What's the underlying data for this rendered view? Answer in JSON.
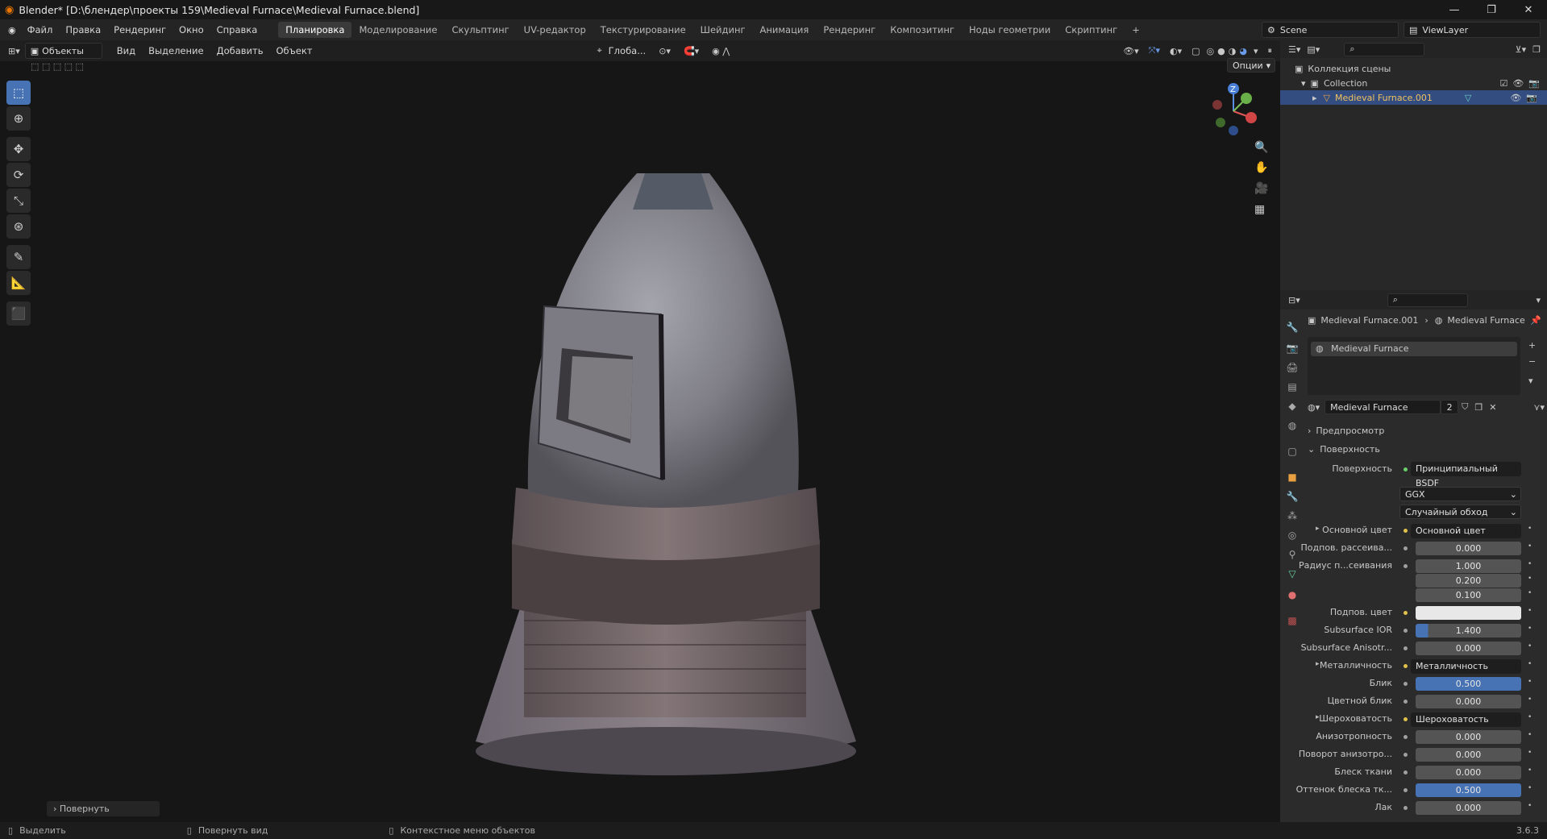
{
  "window": {
    "title": "Blender* [D:\\блендер\\проекты 159\\Medieval Furnace\\Medieval Furnace.blend]"
  },
  "menus": [
    "Файл",
    "Правка",
    "Рендеринг",
    "Окно",
    "Справка"
  ],
  "workspaces": [
    "Планировка",
    "Моделирование",
    "Скульптинг",
    "UV-редактор",
    "Текстурирование",
    "Шейдинг",
    "Анимация",
    "Рендеринг",
    "Композитинг",
    "Ноды геометрии",
    "Скриптинг"
  ],
  "active_workspace": "Планировка",
  "scene": "Scene",
  "view_layer": "ViewLayer",
  "viewport": {
    "mode": "Объекты",
    "menus": [
      "Вид",
      "Выделение",
      "Добавить",
      "Объект"
    ],
    "orientation": "Глоба...",
    "options": "Опции",
    "last_op": "Повернуть"
  },
  "outliner": {
    "root": "Коллекция сцены",
    "collection": "Collection",
    "object": "Medieval Furnace.001"
  },
  "props": {
    "breadcrumb_object": "Medieval Furnace.001",
    "breadcrumb_material": "Medieval Furnace",
    "slot": "Medieval Furnace",
    "material_name": "Medieval Furnace",
    "users": "2",
    "preview": "Предпросмотр",
    "surface_section": "Поверхность",
    "surface_label": "Поверхность",
    "surface_value": "Принципиальный BSDF",
    "distribution": "GGX",
    "subsurface_method": "Случайный обход",
    "fields": [
      {
        "label": "Основной цвет",
        "value": "Основной цвет",
        "kind": "link"
      },
      {
        "label": "Подпов. рассеива...",
        "value": "0.000",
        "kind": "num"
      },
      {
        "label": "Радиус п...сеивания",
        "value": "1.000",
        "kind": "num"
      },
      {
        "label": "",
        "value": "0.200",
        "kind": "num"
      },
      {
        "label": "",
        "value": "0.100",
        "kind": "num"
      },
      {
        "label": "Подпов. цвет",
        "value": "",
        "kind": "color"
      },
      {
        "label": "Subsurface IOR",
        "value": "1.400",
        "kind": "num"
      },
      {
        "label": "Subsurface Anisotr...",
        "value": "0.000",
        "kind": "num"
      },
      {
        "label": "Металличность",
        "value": "Металличность",
        "kind": "link"
      },
      {
        "label": "Блик",
        "value": "0.500",
        "kind": "blue"
      },
      {
        "label": "Цветной блик",
        "value": "0.000",
        "kind": "num"
      },
      {
        "label": "Шероховатость",
        "value": "Шероховатость",
        "kind": "link"
      },
      {
        "label": "Анизотропность",
        "value": "0.000",
        "kind": "num"
      },
      {
        "label": "Поворот анизотро...",
        "value": "0.000",
        "kind": "num"
      },
      {
        "label": "Блеск ткани",
        "value": "0.000",
        "kind": "num"
      },
      {
        "label": "Оттенок блеска тк...",
        "value": "0.500",
        "kind": "blue"
      },
      {
        "label": "Лак",
        "value": "0.000",
        "kind": "num"
      }
    ]
  },
  "status": {
    "left": "Выделить",
    "middle": "Повернуть вид",
    "right": "Контекстное меню объектов",
    "version": "3.6.3"
  },
  "colors": {
    "accent": "#4772b3",
    "selected_row": "#334d80",
    "object_name": "#f0c060"
  }
}
